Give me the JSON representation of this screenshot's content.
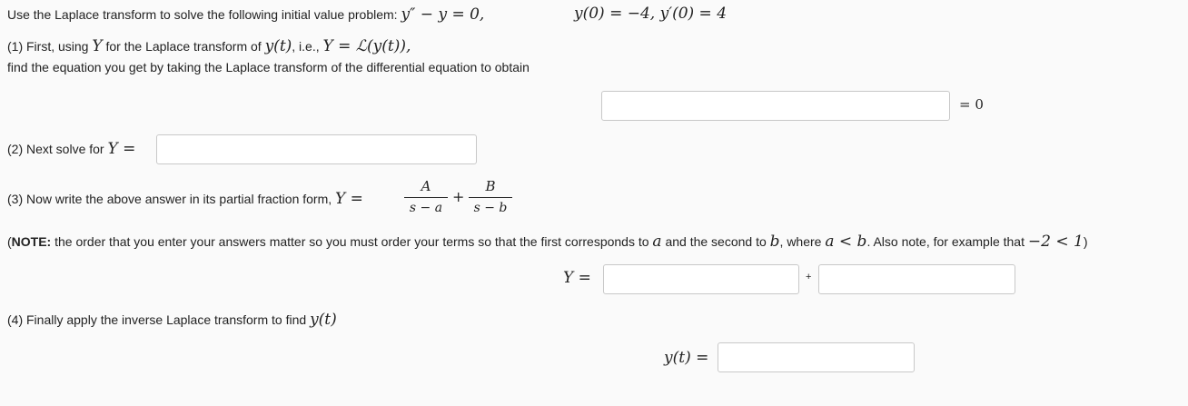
{
  "intro": {
    "text": "Use the Laplace transform to solve the following initial value problem:",
    "equation": "y″ − y = 0,",
    "initial_conditions": "y(0) = −4,  y′(0) = 4"
  },
  "part1": {
    "text_a": "(1) First, using",
    "symbol_Y": "Y",
    "text_b": "for the Laplace transform of",
    "symbol_yt": "y(t)",
    "text_c": ", i.e.,",
    "definition": "Y = ℒ(y(t)),",
    "line2": "find the equation you get by taking the Laplace transform of the differential equation to obtain",
    "input_value": "",
    "equals_zero": "= 0"
  },
  "part2": {
    "text": "(2) Next solve for",
    "lhs": "Y =",
    "input_value": ""
  },
  "part3": {
    "text": "(3) Now write the above answer in its partial fraction form,",
    "lhs": "Y =",
    "frac1_num": "A",
    "frac1_den": "s − a",
    "plus": "+",
    "frac2_num": "B",
    "frac2_den": "s − b"
  },
  "note": {
    "paren_open": "(",
    "bold": "NOTE:",
    "text1": "the order that you enter your answers matter so you must order your terms so that the first corresponds to",
    "a": "a",
    "text2": "and the second to",
    "b": "b",
    "text3": ", where",
    "ineq": "a < b",
    "text4": ". Also note, for example that",
    "example": "−2 < 1",
    "paren_close": ")"
  },
  "part3_answer": {
    "lhs": "Y =",
    "input1_value": "",
    "plus": "+",
    "input2_value": ""
  },
  "part4": {
    "text": "(4) Finally apply the inverse Laplace transform to find",
    "symbol_yt": "y(t)",
    "lhs": "y(t) =",
    "input_value": ""
  }
}
